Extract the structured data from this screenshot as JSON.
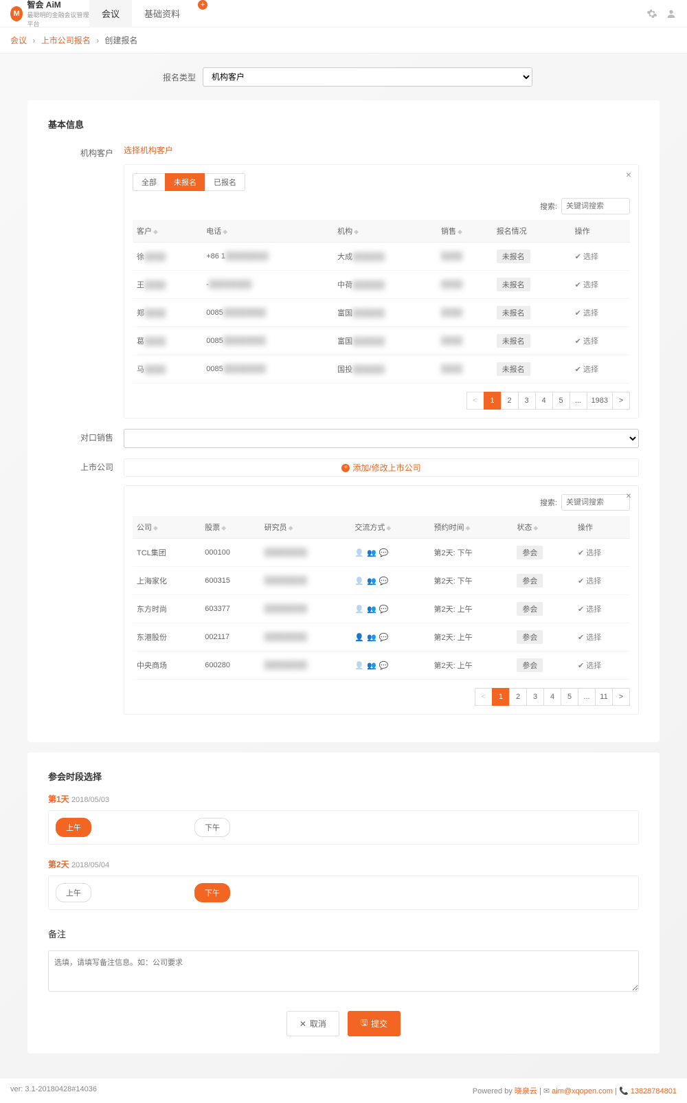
{
  "header": {
    "brand": "智会 AiM",
    "slogan": "最聪明的金融会议管理平台",
    "tabs": [
      "会议",
      "基础资料"
    ]
  },
  "breadcrumb": {
    "items": [
      "会议",
      "上市公司报名"
    ],
    "current": "创建报名"
  },
  "top_form": {
    "type_label": "报名类型",
    "type_value": "机构客户"
  },
  "basic_section": {
    "title": "基本信息",
    "customer_label": "机构客户",
    "choose_customer_link": "选择机构客户",
    "tabs": {
      "all": "全部",
      "not": "未报名",
      "done": "已报名"
    },
    "search_label": "搜索:",
    "search_placeholder": "关键词搜索",
    "cust_cols": {
      "name": "客户",
      "phone": "电话",
      "org": "机构",
      "sales": "销售",
      "status": "报名情况",
      "op": "操作"
    },
    "customers": [
      {
        "name": "徐",
        "phone": "+86 1",
        "org": "大成",
        "sales": "",
        "status": "未报名"
      },
      {
        "name": "王",
        "phone": "-",
        "org": "中荷",
        "sales": "",
        "status": "未报名"
      },
      {
        "name": "郑",
        "phone": "0085",
        "org": "富国",
        "sales": "",
        "status": "未报名"
      },
      {
        "name": "葛",
        "phone": "0085",
        "org": "富国",
        "sales": "",
        "status": "未报名"
      },
      {
        "name": "马",
        "phone": "0085",
        "org": "国投",
        "sales": "",
        "status": "未报名"
      }
    ],
    "select_label": "选择",
    "pages": [
      "<",
      "1",
      "2",
      "3",
      "4",
      "5",
      "...",
      "1983",
      ">"
    ],
    "sales_label": "对口销售",
    "company_label": "上市公司",
    "add_company_link": "添加/修改上市公司",
    "co_cols": {
      "company": "公司",
      "stock": "股票",
      "researcher": "研究员",
      "comm": "交流方式",
      "time": "预约时间",
      "state": "状态",
      "op": "操作"
    },
    "companies": [
      {
        "company": "TCL集团",
        "stock": "000100",
        "time": "第2天: 下午",
        "state": "参会",
        "muted": true
      },
      {
        "company": "上海家化",
        "stock": "600315",
        "time": "第2天: 下午",
        "state": "参会",
        "muted": true
      },
      {
        "company": "东方时尚",
        "stock": "603377",
        "time": "第2天: 上午",
        "state": "参会",
        "muted": true
      },
      {
        "company": "东港股份",
        "stock": "002117",
        "time": "第2天: 上午",
        "state": "参会",
        "muted": false
      },
      {
        "company": "中央商场",
        "stock": "600280",
        "time": "第2天: 上午",
        "state": "参会",
        "muted": true
      }
    ],
    "co_pages": [
      "<",
      "1",
      "2",
      "3",
      "4",
      "5",
      "...",
      "11",
      ">"
    ]
  },
  "slot_section": {
    "title": "参会时段选择",
    "days": [
      {
        "name": "第1天",
        "date": "2018/05/03",
        "slots": [
          {
            "label": "上午",
            "active": true
          },
          {
            "label": "下午",
            "active": false
          }
        ]
      },
      {
        "name": "第2天",
        "date": "2018/05/04",
        "slots": [
          {
            "label": "上午",
            "active": false
          },
          {
            "label": "下午",
            "active": true
          }
        ]
      }
    ]
  },
  "remarks": {
    "label": "备注",
    "placeholder": "选填，请填写备注信息。如：公司要求"
  },
  "actions": {
    "cancel": "取消",
    "submit": "提交"
  },
  "footer": {
    "ver": "ver: 3.1-20180428#14036",
    "powered": "Powered by ",
    "company": "晓泉云",
    "email": "aim@xqopen.com",
    "phone": "13828784801"
  }
}
